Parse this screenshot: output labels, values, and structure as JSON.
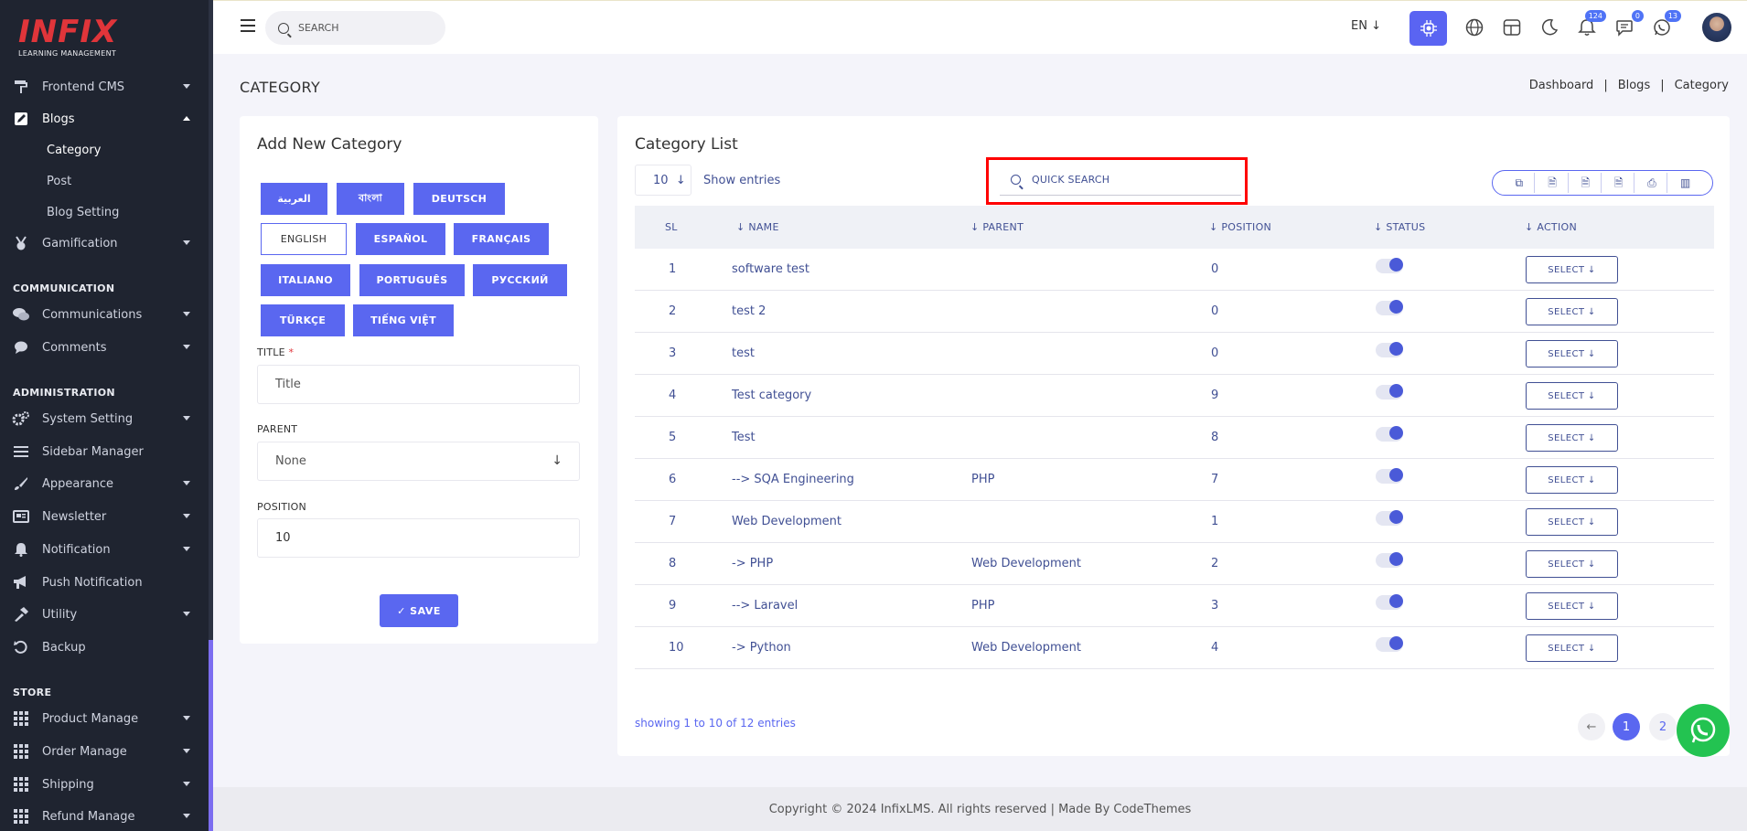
{
  "brand": {
    "logo_main": "INFIX",
    "logo_sub": "LEARNING MANAGEMENT"
  },
  "sidebar": {
    "items": [
      {
        "label": "Frontend CMS",
        "icon": "paint-roller-icon"
      },
      {
        "label": "Blogs",
        "icon": "edit-icon"
      },
      {
        "label": "Gamification",
        "icon": "medal-icon"
      },
      {
        "label": "Communications",
        "icon": "chat-icon"
      },
      {
        "label": "Comments",
        "icon": "comment-icon"
      },
      {
        "label": "System Setting",
        "icon": "gears-icon"
      },
      {
        "label": "Sidebar Manager",
        "icon": "bars-icon"
      },
      {
        "label": "Appearance",
        "icon": "brush-icon"
      },
      {
        "label": "Newsletter",
        "icon": "newsletter-icon"
      },
      {
        "label": "Notification",
        "icon": "bell-icon"
      },
      {
        "label": "Push Notification",
        "icon": "megaphone-icon"
      },
      {
        "label": "Utility",
        "icon": "hammer-icon"
      },
      {
        "label": "Backup",
        "icon": "backup-icon"
      },
      {
        "label": "Product Manage",
        "icon": "grid-icon"
      },
      {
        "label": "Order Manage",
        "icon": "grid-icon"
      },
      {
        "label": "Shipping",
        "icon": "grid-icon"
      },
      {
        "label": "Refund Manage",
        "icon": "grid-icon"
      }
    ],
    "sub_items": [
      "Category",
      "Post",
      "Blog Setting"
    ],
    "sections": [
      "COMMUNICATION",
      "ADMINISTRATION",
      "STORE"
    ]
  },
  "topbar": {
    "search_placeholder": "SEARCH",
    "lang": "EN ↓",
    "badges": {
      "notifications": "124",
      "messages": "0",
      "whatsapp": "13"
    }
  },
  "page": {
    "title": "CATEGORY",
    "breadcrumb": [
      "Dashboard",
      "Blogs",
      "Category"
    ]
  },
  "form": {
    "title": "Add New Category",
    "languages": [
      "العربية",
      "বাংলা",
      "DEUTSCH",
      "ENGLISH",
      "ESPAÑOL",
      "FRANÇAIS",
      "ITALIANO",
      "PORTUGUÊS",
      "РУССКИЙ",
      "TÜRKÇE",
      "TIẾNG VIỆT"
    ],
    "title_label": "TITLE",
    "title_required": "*",
    "title_placeholder": "Title",
    "parent_label": "PARENT",
    "parent_value": "None",
    "position_label": "POSITION",
    "position_value": "10",
    "save_label": "✓ SAVE"
  },
  "list": {
    "title": "Category List",
    "entries_value": "10",
    "entries_label": "Show entries",
    "quick_search_placeholder": "QUICK SEARCH",
    "columns": [
      "SL",
      "↓ NAME",
      "↓ PARENT",
      "↓ POSITION",
      "↓ STATUS",
      "↓ ACTION"
    ],
    "rows": [
      {
        "sl": "1",
        "name": "software test",
        "parent": "",
        "position": "0",
        "status": true
      },
      {
        "sl": "2",
        "name": "test 2",
        "parent": "",
        "position": "0",
        "status": true
      },
      {
        "sl": "3",
        "name": "test",
        "parent": "",
        "position": "0",
        "status": true
      },
      {
        "sl": "4",
        "name": "Test category",
        "parent": "",
        "position": "9",
        "status": true
      },
      {
        "sl": "5",
        "name": "Test",
        "parent": "",
        "position": "8",
        "status": true
      },
      {
        "sl": "6",
        "name": "--> SQA Engineering",
        "parent": "PHP",
        "position": "7",
        "status": true
      },
      {
        "sl": "7",
        "name": "Web Development",
        "parent": "",
        "position": "1",
        "status": true
      },
      {
        "sl": "8",
        "name": "-> PHP",
        "parent": "Web Development",
        "position": "2",
        "status": true
      },
      {
        "sl": "9",
        "name": "--> Laravel",
        "parent": "PHP",
        "position": "3",
        "status": true
      },
      {
        "sl": "10",
        "name": "-> Python",
        "parent": "Web Development",
        "position": "4",
        "status": true
      }
    ],
    "select_label": "SELECT ↓",
    "showing_text": "showing 1 to 10 of 12 entries",
    "pages": [
      "1",
      "2"
    ],
    "prev_label": "←"
  },
  "footer": {
    "text": "Copyright © 2024 InfixLMS. All rights reserved | Made By CodeThemes"
  },
  "colors": {
    "primary": "#5a67f0",
    "sidebar_bg": "#1f2430",
    "text": "#415094",
    "highlight": "#ff0000",
    "whatsapp": "#23c351"
  }
}
